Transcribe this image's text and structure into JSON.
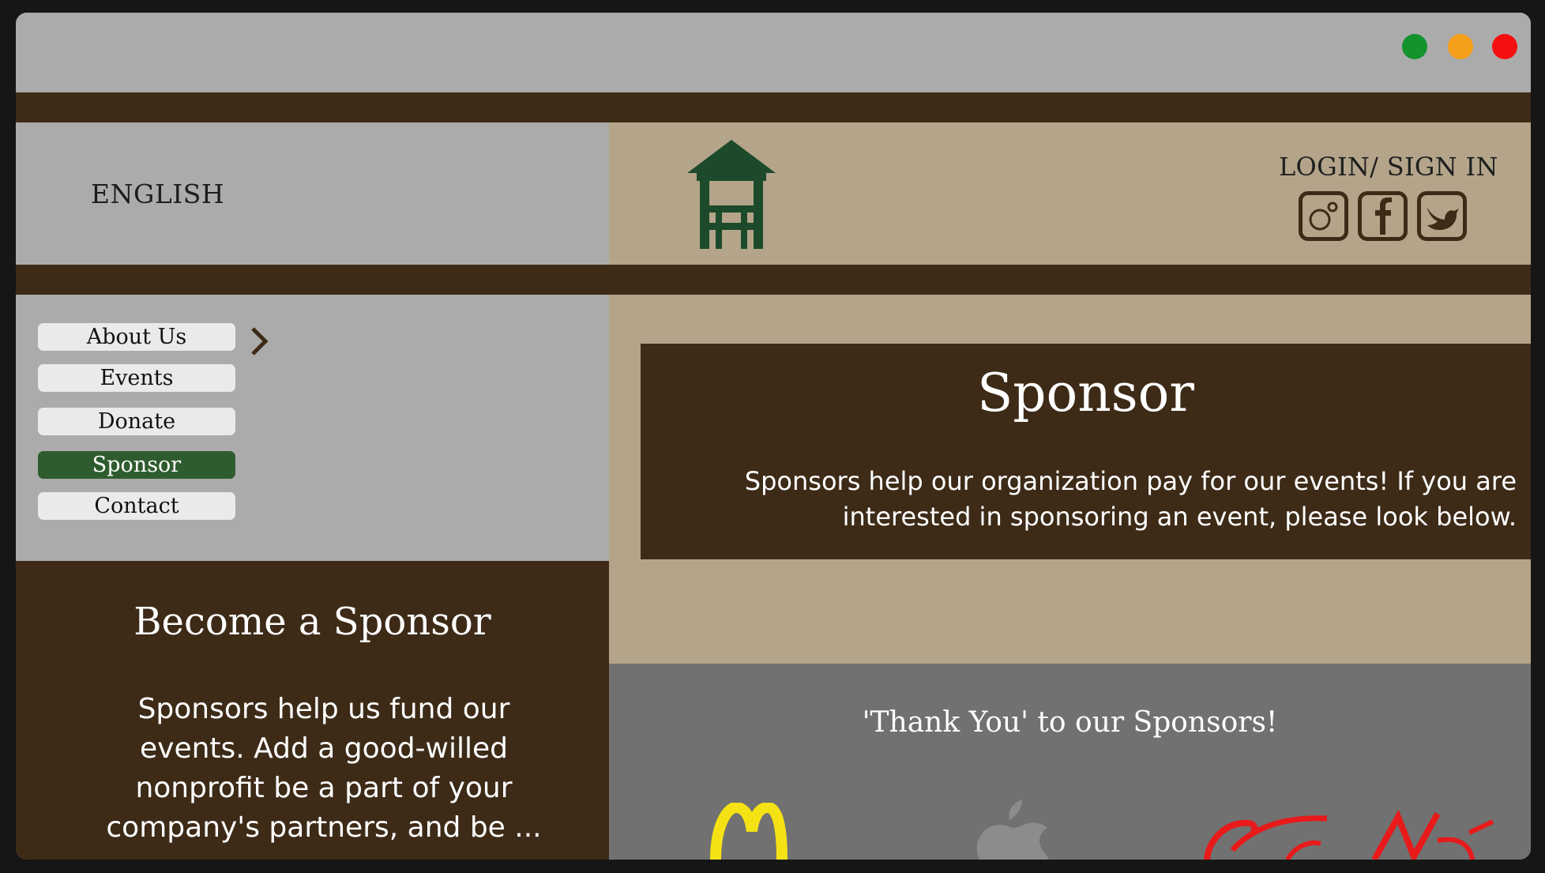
{
  "window": {
    "controls": {
      "green": "#14922e",
      "orange": "#f59e1a",
      "red": "#f51010"
    }
  },
  "header": {
    "language": "ENGLISH",
    "login": "LOGIN/ SIGN IN",
    "logo_icon": "watchtower-icon",
    "social": [
      "instagram-icon",
      "facebook-icon",
      "twitter-icon"
    ]
  },
  "nav": {
    "items": [
      {
        "label": "About Us",
        "active": false
      },
      {
        "label": "Events",
        "active": false
      },
      {
        "label": "Donate",
        "active": false
      },
      {
        "label": "Sponsor",
        "active": true
      },
      {
        "label": "Contact",
        "active": false
      }
    ],
    "chevron": "chevron-right-icon"
  },
  "main": {
    "title": "Sponsor",
    "description": "Sponsors help our organization pay for our events! If you are interested in sponsoring an event, please look below."
  },
  "sidebar": {
    "title": "Become a Sponsor",
    "text": "Sponsors help us fund our events. Add a good-willed nonprofit be a part of your company's partners, and be ..."
  },
  "sponsors": {
    "heading": "'Thank You' to our Sponsors!",
    "logos": [
      "golden-arches-logo",
      "apple-logo",
      "red-script-logo"
    ]
  },
  "colors": {
    "brown": "#3d2b18",
    "beige": "#b4a58a",
    "gray": "#ababab",
    "dark_gray": "#717171",
    "active_green": "#2f5c2f",
    "logo_green": "#1d4a2a"
  }
}
